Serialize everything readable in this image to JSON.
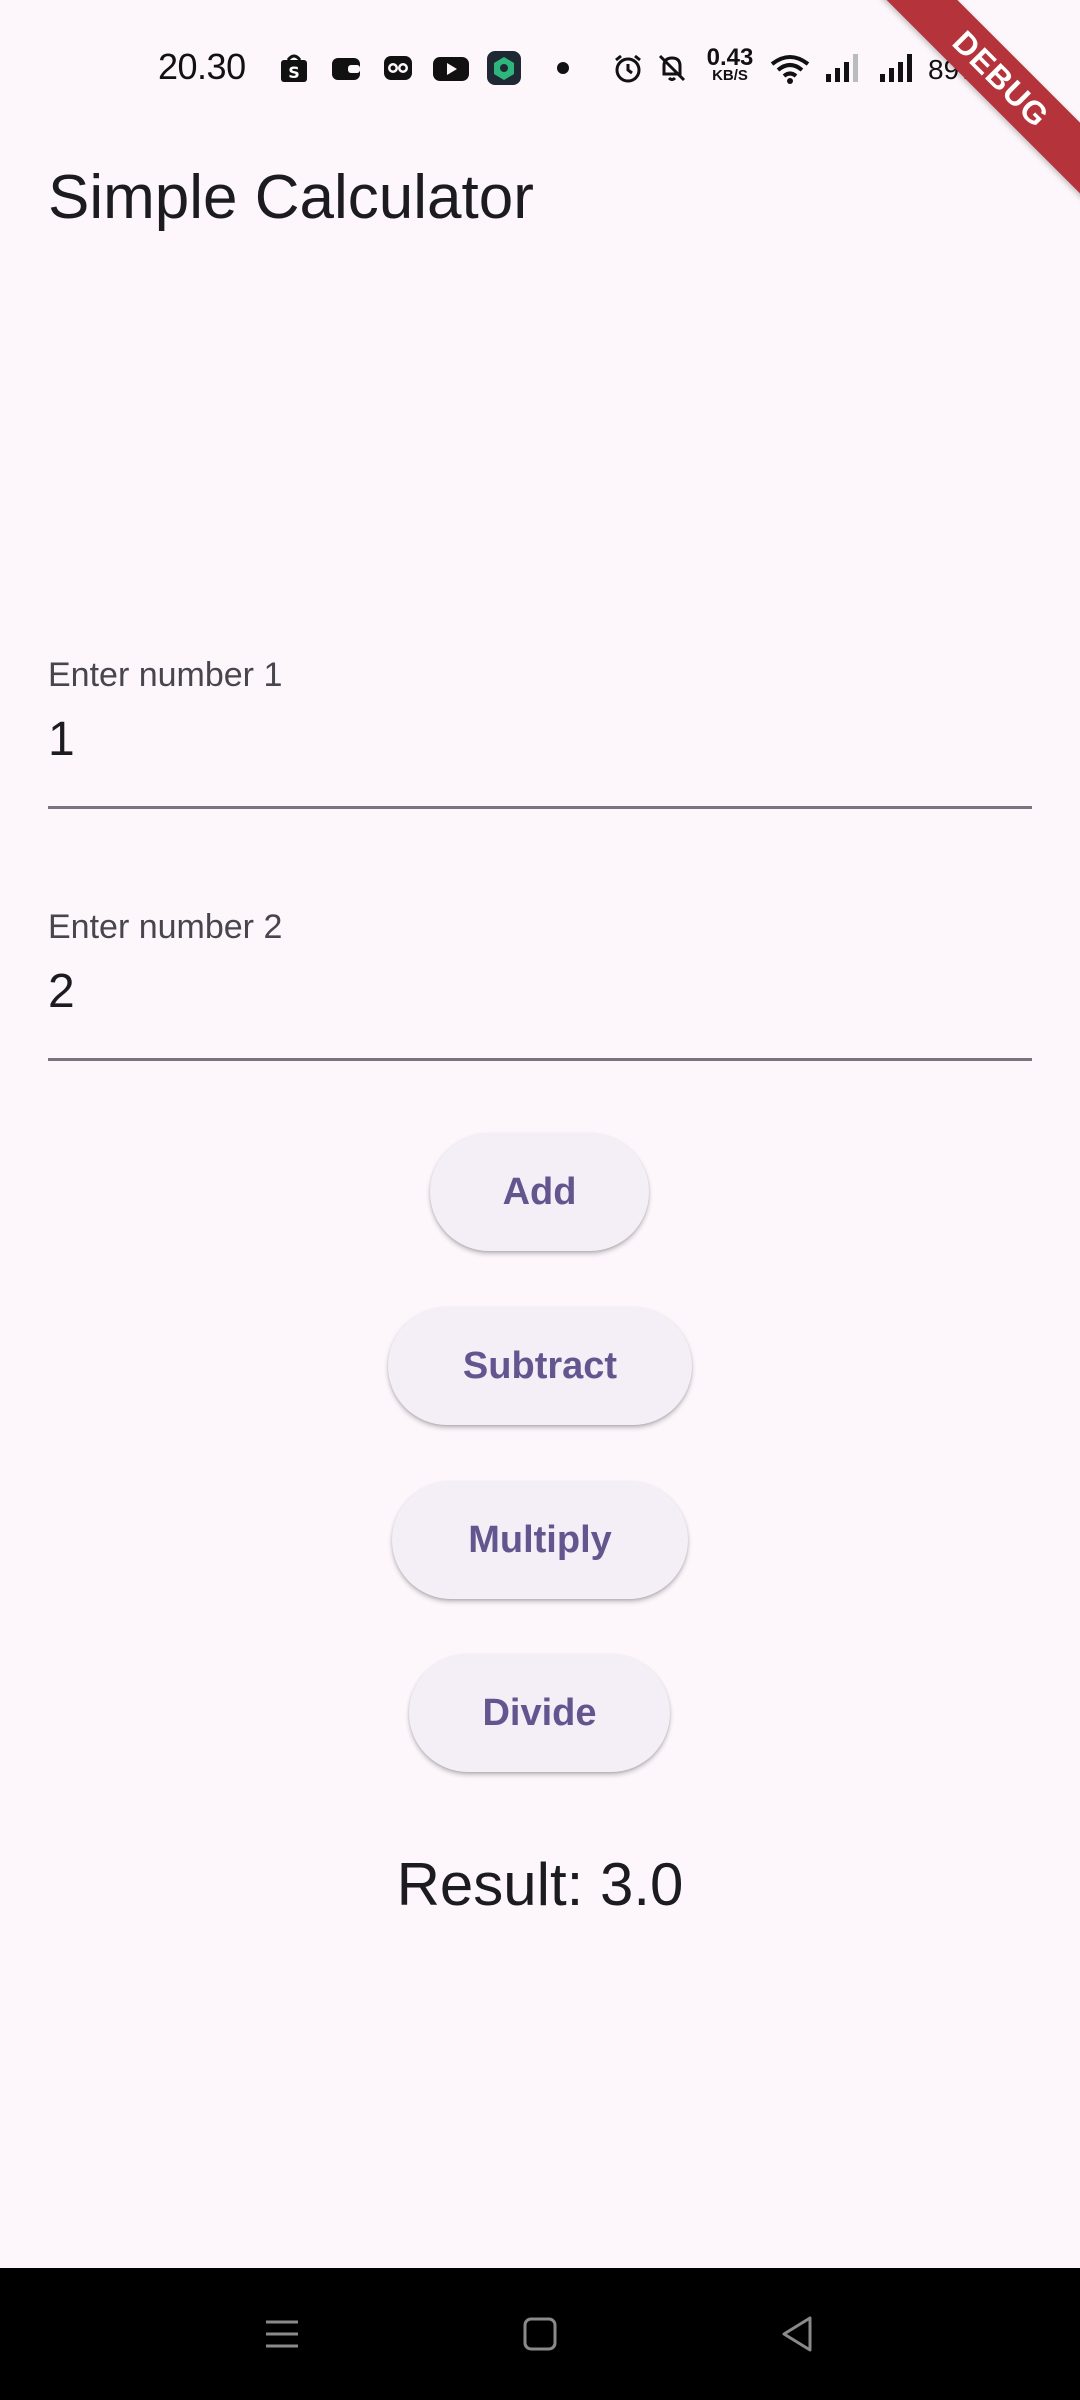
{
  "status_bar": {
    "time": "20.30",
    "net_speed_value": "0.43",
    "net_speed_unit": "KB/S",
    "battery": "89%",
    "icons": [
      "shopee-icon",
      "wallet-icon",
      "owl-icon",
      "youtube-icon",
      "app-icon",
      "notification-dot",
      "alarm-icon",
      "mute-icon",
      "wifi-icon",
      "signal-icon",
      "signal-icon-2",
      "charging-icon"
    ]
  },
  "debug_banner": "DEBUG",
  "app_bar": {
    "title": "Simple Calculator"
  },
  "fields": [
    {
      "label": "Enter number 1",
      "value": "1"
    },
    {
      "label": "Enter number 2",
      "value": "2"
    }
  ],
  "buttons": {
    "add": "Add",
    "subtract": "Subtract",
    "multiply": "Multiply",
    "divide": "Divide"
  },
  "result": "Result: 3.0",
  "colors": {
    "background": "#fdf7fb",
    "button_bg": "#f4eef7",
    "button_text": "#65558f",
    "debug_banner": "#b5333b"
  },
  "nav_bar": {
    "icons": [
      "menu-icon",
      "home-icon",
      "back-icon"
    ]
  }
}
